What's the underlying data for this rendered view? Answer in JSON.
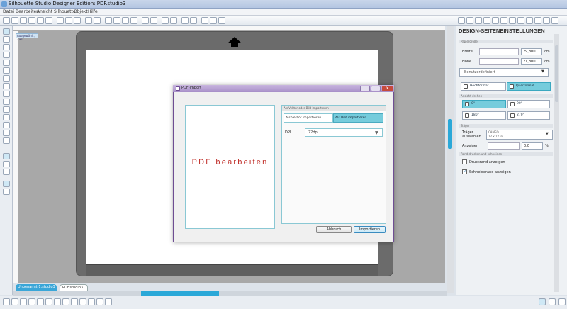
{
  "window": {
    "title": "Silhouette Studio Designer Edition: PDF.studio3"
  },
  "menu": [
    "Datei",
    "Bearbeiten",
    "Ansicht",
    "Silhouette",
    "Objekt",
    "Hilfe"
  ],
  "canvas": {
    "tab_label": "Ausgewählt / Ziel"
  },
  "dialog": {
    "title": "PDF-Import",
    "close": "x",
    "preview_text": "PDF bearbeiten",
    "section_header": "Als Vektor oder Bild importieren",
    "tab_vector": "Als Vektor importieren",
    "tab_image": "Als Bild importieren",
    "dpi_label": "DPI",
    "dpi_value": "72dpi",
    "dpi_arrow": "▼",
    "cancel": "Abbruch",
    "import": "Importieren"
  },
  "panel": {
    "title": "DESIGN-SEITENEINSTELLUNGEN",
    "sec_size": "Papiergröße",
    "width_label": "Breite",
    "width_value": "29,800",
    "height_label": "Höhe",
    "height_value": "21,800",
    "unit": "cm",
    "media_select": "Benutzerdefiniert",
    "media_arrow": "▼",
    "portrait": "Hochformat",
    "landscape": "Querformat",
    "sec_rotate": "Ansicht drehen",
    "rot0": "0°",
    "rot90": "90°",
    "rot180": "180°",
    "rot270": "270°",
    "sec_carrier": "Träger",
    "carrier_label": "Träger auswählen",
    "carrier_value": "CAMEO",
    "carrier_sub": "12 x 12 in",
    "carrier_arrow": "▼",
    "show_label": "Anzeigen",
    "show_value": "0,0",
    "show_unit": "%",
    "sec_margin": "Rand drucken und schneiden",
    "print_margin": "Druckrand anzeigen",
    "cut_margin": "Schneiderand anzeigen",
    "check_mark": "✓"
  },
  "tabs": {
    "untitled": "Unbenannt-1.studio3",
    "untitled_close": "x",
    "pdf": "PDF.studio3",
    "pdf_close": "x"
  }
}
